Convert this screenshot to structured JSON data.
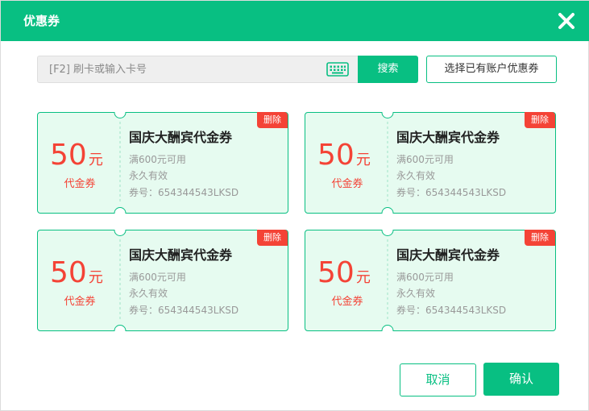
{
  "dialog": {
    "title": "优惠券"
  },
  "search": {
    "placeholder": "[F2] 刷卡或输入卡号",
    "value": "",
    "button_label": "搜索"
  },
  "toolbar": {
    "select_existing_label": "选择已有账户优惠券"
  },
  "coupons": [
    {
      "amount": "50",
      "unit": "元",
      "type": "代金券",
      "name": "国庆大酬宾代金券",
      "condition": "满600元可用",
      "validity": "永久有效",
      "code": "券号：654344543LKSD",
      "delete_label": "删除"
    },
    {
      "amount": "50",
      "unit": "元",
      "type": "代金券",
      "name": "国庆大酬宾代金券",
      "condition": "满600元可用",
      "validity": "永久有效",
      "code": "券号：654344543LKSD",
      "delete_label": "删除"
    },
    {
      "amount": "50",
      "unit": "元",
      "type": "代金券",
      "name": "国庆大酬宾代金券",
      "condition": "满600元可用",
      "validity": "永久有效",
      "code": "券号：654344543LKSD",
      "delete_label": "删除"
    },
    {
      "amount": "50",
      "unit": "元",
      "type": "代金券",
      "name": "国庆大酬宾代金券",
      "condition": "满600元可用",
      "validity": "永久有效",
      "code": "券号：654344543LKSD",
      "delete_label": "删除"
    }
  ],
  "footer": {
    "cancel_label": "取消",
    "confirm_label": "确认"
  },
  "colors": {
    "accent": "#08bf82",
    "coupon_bg": "#e6fbf0",
    "danger": "#f44336"
  }
}
